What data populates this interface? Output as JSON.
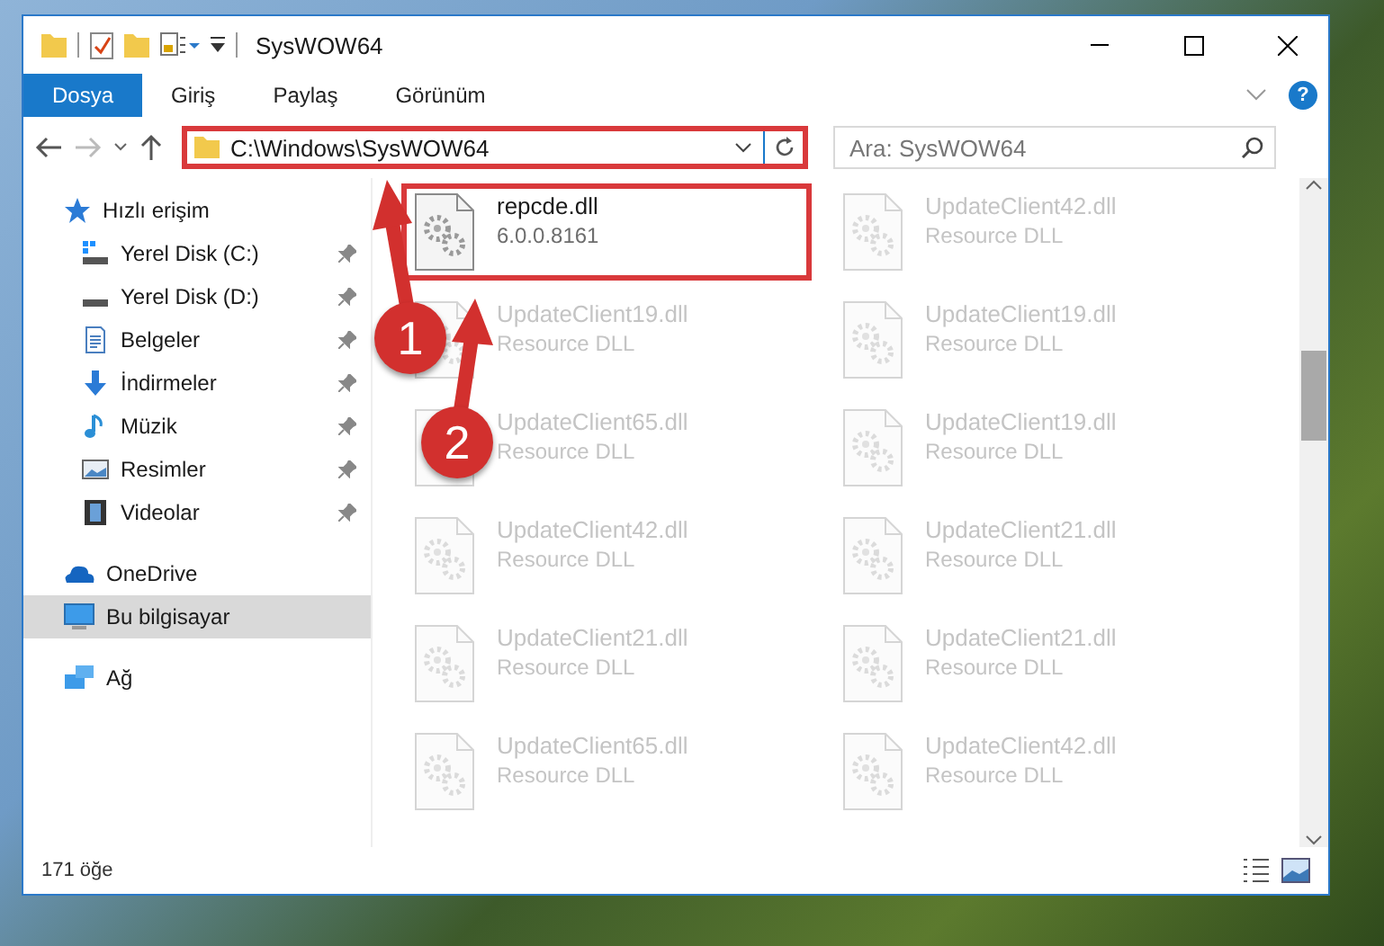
{
  "window": {
    "title": "SysWOW64"
  },
  "ribbon": {
    "tabs": [
      {
        "label": "Dosya",
        "selected": true
      },
      {
        "label": "Giriş",
        "selected": false
      },
      {
        "label": "Paylaş",
        "selected": false
      },
      {
        "label": "Görünüm",
        "selected": false
      }
    ],
    "help": "?"
  },
  "address": {
    "path": "C:\\Windows\\SysWOW64",
    "highlighted": true
  },
  "search": {
    "placeholder": "Ara: SysWOW64"
  },
  "sidebar": {
    "items": [
      {
        "label": "Hızlı erişim",
        "selected": false,
        "children": [
          {
            "label": "Yerel Disk (C:)",
            "selected": false,
            "pinned": true
          },
          {
            "label": "Yerel Disk (D:)",
            "selected": false,
            "pinned": true
          },
          {
            "label": "Belgeler",
            "selected": false,
            "pinned": true
          },
          {
            "label": "İndirmeler",
            "selected": false,
            "pinned": true
          },
          {
            "label": "Müzik",
            "selected": false,
            "pinned": true
          },
          {
            "label": "Resimler",
            "selected": false,
            "pinned": true
          },
          {
            "label": "Videolar",
            "selected": false,
            "pinned": true
          }
        ]
      },
      {
        "label": "OneDrive",
        "selected": false
      },
      {
        "label": "Bu bilgisayar",
        "selected": true
      },
      {
        "label": "Ağ",
        "selected": false
      }
    ]
  },
  "files": [
    {
      "name": "repcde.dll",
      "detail": "6.0.0.8161",
      "highlighted": true,
      "dimmed": false
    },
    {
      "name": "UpdateClient42.dll",
      "detail": "Resource DLL",
      "highlighted": false,
      "dimmed": true
    },
    {
      "name": "UpdateClient19.dll",
      "detail": "Resource DLL",
      "highlighted": false,
      "dimmed": true
    },
    {
      "name": "UpdateClient19.dll",
      "detail": "Resource DLL",
      "highlighted": false,
      "dimmed": true
    },
    {
      "name": "UpdateClient65.dll",
      "detail": "Resource DLL",
      "highlighted": false,
      "dimmed": true
    },
    {
      "name": "UpdateClient19.dll",
      "detail": "Resource DLL",
      "highlighted": false,
      "dimmed": true
    },
    {
      "name": "UpdateClient42.dll",
      "detail": "Resource DLL",
      "highlighted": false,
      "dimmed": true
    },
    {
      "name": "UpdateClient21.dll",
      "detail": "Resource DLL",
      "highlighted": false,
      "dimmed": true
    },
    {
      "name": "UpdateClient21.dll",
      "detail": "Resource DLL",
      "highlighted": false,
      "dimmed": true
    },
    {
      "name": "UpdateClient21.dll",
      "detail": "Resource DLL",
      "highlighted": false,
      "dimmed": true
    },
    {
      "name": "UpdateClient65.dll",
      "detail": "Resource DLL",
      "highlighted": false,
      "dimmed": true
    },
    {
      "name": "UpdateClient42.dll",
      "detail": "Resource DLL",
      "highlighted": false,
      "dimmed": true
    }
  ],
  "status_bar": {
    "count": "171 öğe"
  },
  "annotations": [
    {
      "number": "1"
    },
    {
      "number": "2"
    }
  ]
}
